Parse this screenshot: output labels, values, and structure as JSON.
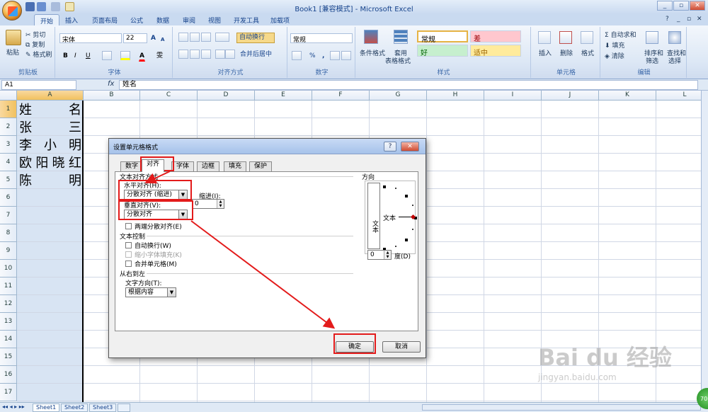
{
  "window": {
    "title": "Book1 [兼容模式] - Microsoft Excel",
    "controls": [
      "_",
      "▫",
      "✕"
    ],
    "ribbon_controls": [
      "?",
      "_",
      "▫",
      "✕"
    ]
  },
  "tabs": [
    "开始",
    "插入",
    "页面布局",
    "公式",
    "数据",
    "审阅",
    "视图",
    "开发工具",
    "加载项"
  ],
  "ribbon": {
    "clipboard": {
      "label": "剪贴板",
      "paste": "粘贴",
      "cut": "剪切",
      "copy": "复制",
      "format_painter": "格式刷"
    },
    "font": {
      "label": "字体",
      "name": "宋体",
      "size": "22",
      "grow": "A",
      "shrink": "A",
      "bold": "B",
      "italic": "I",
      "underline": "U",
      "font_color": "A",
      "phonetic": "雯"
    },
    "alignment": {
      "label": "对齐方式",
      "wrap": "自动换行",
      "merge": "合并后居中"
    },
    "number": {
      "label": "数字",
      "format": "常规",
      "percent": "%",
      "comma": ","
    },
    "styles": {
      "label": "样式",
      "conditional": "条件格式",
      "table": "套用",
      "table2": "表格格式",
      "normal": "常规",
      "bad": "差",
      "good": "好",
      "neutral": "适中"
    },
    "cells": {
      "label": "单元格",
      "insert": "插入",
      "delete": "删除",
      "format": "格式"
    },
    "editing": {
      "label": "编辑",
      "autosum": "自动求和",
      "fill": "填充",
      "clear": "清除",
      "sort": "排序和",
      "sort2": "筛选",
      "find": "查找和",
      "find2": "选择"
    }
  },
  "formula_bar": {
    "name_box": "A1",
    "fx": "fx",
    "content": "姓名"
  },
  "columns": [
    "A",
    "B",
    "C",
    "D",
    "E",
    "F",
    "G",
    "H",
    "I",
    "J",
    "K",
    "L"
  ],
  "rows": [
    "1",
    "2",
    "3",
    "4",
    "5",
    "6",
    "7",
    "8",
    "9",
    "10",
    "11",
    "12",
    "13",
    "14",
    "15",
    "16",
    "17"
  ],
  "cells": [
    "姓名",
    "张三",
    "李小明",
    "欧阳晓红",
    "陈明"
  ],
  "sheets": [
    "Sheet1",
    "Sheet2",
    "Sheet3"
  ],
  "dialog": {
    "title": "设置单元格格式",
    "help": "?",
    "close": "✕",
    "tabs": [
      "数字",
      "对齐",
      "字体",
      "边框",
      "填充",
      "保护"
    ],
    "text_alignment_title": "文本对齐方式",
    "horizontal_label": "水平对齐(H):",
    "horizontal_value": "分散对齐 (缩进)",
    "indent_label": "缩进(I):",
    "indent_value": "0",
    "vertical_label": "垂直对齐(V):",
    "vertical_value": "分散对齐",
    "justify_distributed": "两端分散对齐(E)",
    "text_control_title": "文本控制",
    "wrap_text": "自动换行(W)",
    "shrink_fit": "缩小字体填充(K)",
    "merge_cells": "合并单元格(M)",
    "rtl_title": "从右到左",
    "text_direction_label": "文字方向(T):",
    "text_direction_value": "根据内容",
    "orientation_title": "方向",
    "vertical_text": "文本",
    "horizontal_text": "文本",
    "degrees_value": "0",
    "degrees_label": "度(D)",
    "ok": "确定",
    "cancel": "取消"
  },
  "watermark": {
    "logo": "Bai du 经验",
    "url": "jingyan.baidu.com"
  },
  "badge": "70",
  "accent_colors": {
    "annotation": "#e31b1b",
    "selected_header": "#f1c15f",
    "ribbon": "#dce7f5"
  }
}
